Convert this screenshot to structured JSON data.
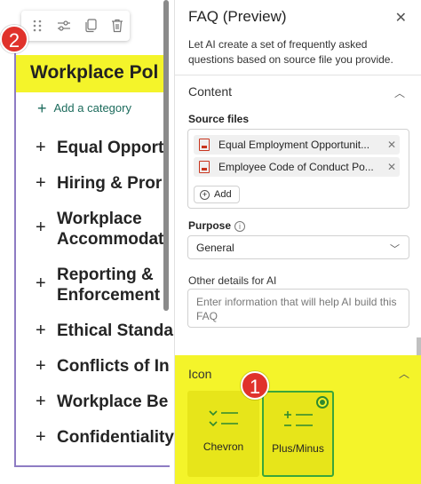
{
  "canvas": {
    "section_title": "Workplace Pol",
    "add_category": "Add a category",
    "faq_items": [
      {
        "toggle": "+",
        "label": "Equal Opport"
      },
      {
        "toggle": "+",
        "label": "Hiring & Pror"
      },
      {
        "toggle": "+",
        "label": "Workplace\nAccommodat"
      },
      {
        "toggle": "+",
        "label": "Reporting &\nEnforcement"
      },
      {
        "toggle": "+",
        "label": "Ethical Standa"
      },
      {
        "toggle": "+",
        "label": "Conflicts of In"
      },
      {
        "toggle": "+",
        "label": "Workplace Be"
      },
      {
        "toggle": "+",
        "label": "Confidentiality"
      }
    ],
    "toolbar_icons": [
      "drag-handle-icon",
      "settings-sliders-icon",
      "duplicate-icon",
      "delete-icon"
    ]
  },
  "annotations": {
    "badge_1": "1",
    "badge_2": "2"
  },
  "panel": {
    "title": "FAQ (Preview)",
    "close": "✕",
    "description": "Let AI create a set of frequently asked questions based on source file you provide.",
    "content_section": {
      "header": "Content",
      "source_files_label": "Source files",
      "files": [
        {
          "name": "Equal Employment Opportunit..."
        },
        {
          "name": "Employee Code of Conduct Po..."
        }
      ],
      "add_label": "Add",
      "purpose_label": "Purpose",
      "purpose_value": "General",
      "details_label": "Other details for AI",
      "details_placeholder": "Enter information that will help AI build this FAQ"
    },
    "icon_section": {
      "header": "Icon",
      "options": [
        {
          "label": "Chevron",
          "selected": false
        },
        {
          "label": "Plus/Minus",
          "selected": true
        }
      ]
    }
  },
  "colors": {
    "highlight_yellow": "#f4f42a",
    "badge_red": "#e0322b",
    "selected_green": "#3aa63a",
    "section_border": "#8e7cc3",
    "link_teal": "#1c6b5c"
  }
}
